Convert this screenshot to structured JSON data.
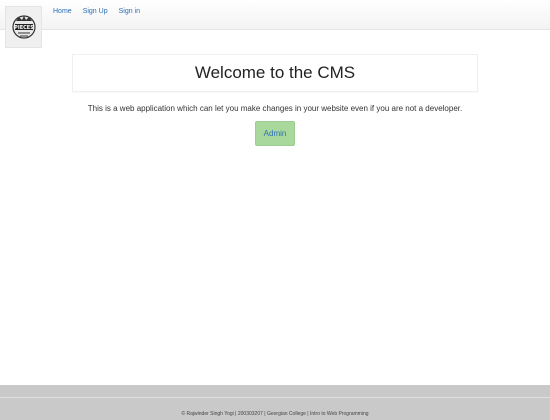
{
  "nav": {
    "logo_text": "PIECES",
    "links": [
      {
        "label": "Home"
      },
      {
        "label": "Sign Up"
      },
      {
        "label": "Sign in"
      }
    ]
  },
  "main": {
    "title": "Welcome to the CMS",
    "intro": "This is a web application which can let you make changes in your website even if you are not a developer.",
    "admin_label": "Admin"
  },
  "footer": {
    "text": "© Rajwinder Singh Yogi | 200303207 | Georgian College | Intro to Web Programming"
  },
  "colors": {
    "link": "#2a6bb5",
    "admin_button_bg": "#a9d89c",
    "footer_bg": "#c9c9c9"
  }
}
